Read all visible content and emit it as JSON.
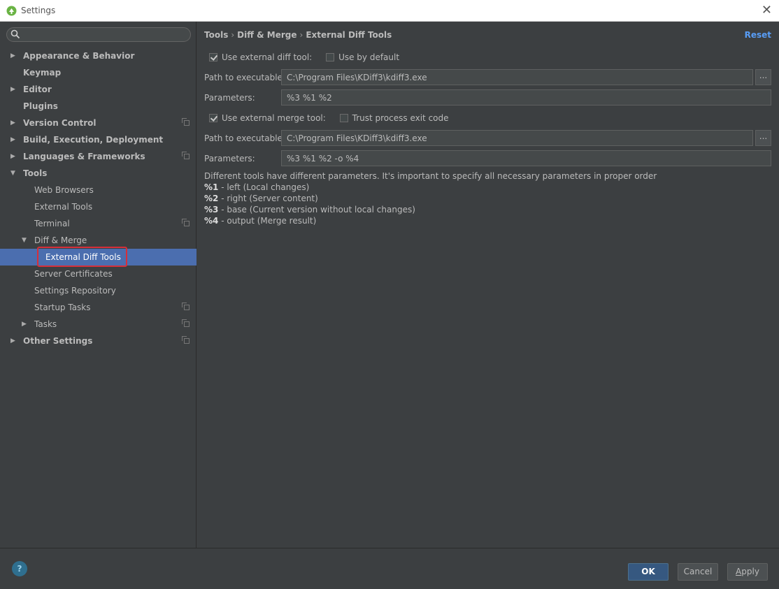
{
  "window": {
    "title": "Settings",
    "close_glyph": "✕"
  },
  "search": {
    "placeholder": "",
    "value": ""
  },
  "tree": {
    "items": [
      {
        "label": "Appearance & Behavior",
        "level": 0,
        "arrow": "▶",
        "bold": true,
        "project": false
      },
      {
        "label": "Keymap",
        "level": 0,
        "arrow": "",
        "bold": true,
        "project": false
      },
      {
        "label": "Editor",
        "level": 0,
        "arrow": "▶",
        "bold": true,
        "project": false
      },
      {
        "label": "Plugins",
        "level": 0,
        "arrow": "",
        "bold": true,
        "project": false
      },
      {
        "label": "Version Control",
        "level": 0,
        "arrow": "▶",
        "bold": true,
        "project": true
      },
      {
        "label": "Build, Execution, Deployment",
        "level": 0,
        "arrow": "▶",
        "bold": true,
        "project": false
      },
      {
        "label": "Languages & Frameworks",
        "level": 0,
        "arrow": "▶",
        "bold": true,
        "project": true
      },
      {
        "label": "Tools",
        "level": 0,
        "arrow": "▼",
        "bold": true,
        "project": false
      },
      {
        "label": "Web Browsers",
        "level": 1,
        "arrow": "",
        "bold": false,
        "project": false
      },
      {
        "label": "External Tools",
        "level": 1,
        "arrow": "",
        "bold": false,
        "project": false
      },
      {
        "label": "Terminal",
        "level": 1,
        "arrow": "",
        "bold": false,
        "project": true
      },
      {
        "label": "Diff & Merge",
        "level": 1,
        "arrow": "▼",
        "bold": false,
        "project": false
      },
      {
        "label": "External Diff Tools",
        "level": 2,
        "arrow": "",
        "bold": false,
        "project": false,
        "selected": true
      },
      {
        "label": "Server Certificates",
        "level": 1,
        "arrow": "",
        "bold": false,
        "project": false
      },
      {
        "label": "Settings Repository",
        "level": 1,
        "arrow": "",
        "bold": false,
        "project": false
      },
      {
        "label": "Startup Tasks",
        "level": 1,
        "arrow": "",
        "bold": false,
        "project": true
      },
      {
        "label": "Tasks",
        "level": 1,
        "arrow": "▶",
        "bold": false,
        "project": true
      },
      {
        "label": "Other Settings",
        "level": 0,
        "arrow": "▶",
        "bold": true,
        "project": true
      }
    ]
  },
  "breadcrumb": {
    "part1": "Tools",
    "part2": "Diff & Merge",
    "part3": "External Diff Tools",
    "sep": "›"
  },
  "reset_label": "Reset",
  "diff": {
    "use_tool_label": "Use external diff tool:",
    "use_tool_checked": true,
    "use_default_label": "Use by default",
    "use_default_checked": false,
    "path_label": "Path to executable:",
    "path_value": "C:\\Program Files\\KDiff3\\kdiff3.exe",
    "params_label": "Parameters:",
    "params_value": "%3 %1 %2"
  },
  "merge": {
    "use_tool_label": "Use external merge tool:",
    "use_tool_checked": true,
    "trust_exit_label": "Trust process exit code",
    "trust_exit_checked": false,
    "path_label": "Path to executable:",
    "path_value": "C:\\Program Files\\KDiff3\\kdiff3.exe",
    "params_label": "Parameters:",
    "params_value": "%3 %1 %2 -o %4"
  },
  "browse_label": "...",
  "notes": {
    "intro": "Different tools have different parameters. It's important to specify all necessary parameters in proper order",
    "lines": [
      {
        "key": "%1",
        "text": " - left (Local changes)"
      },
      {
        "key": "%2",
        "text": " - right (Server content)"
      },
      {
        "key": "%3",
        "text": " - base (Current version without local changes)"
      },
      {
        "key": "%4",
        "text": " - output (Merge result)"
      }
    ]
  },
  "footer": {
    "help": "?",
    "ok": "OK",
    "cancel": "Cancel",
    "apply_u": "A",
    "apply_rest": "pply"
  },
  "colors": {
    "selection": "#4b6eaf",
    "link": "#589df6",
    "highlight": "#d62f3a",
    "background": "#3c3f41"
  }
}
